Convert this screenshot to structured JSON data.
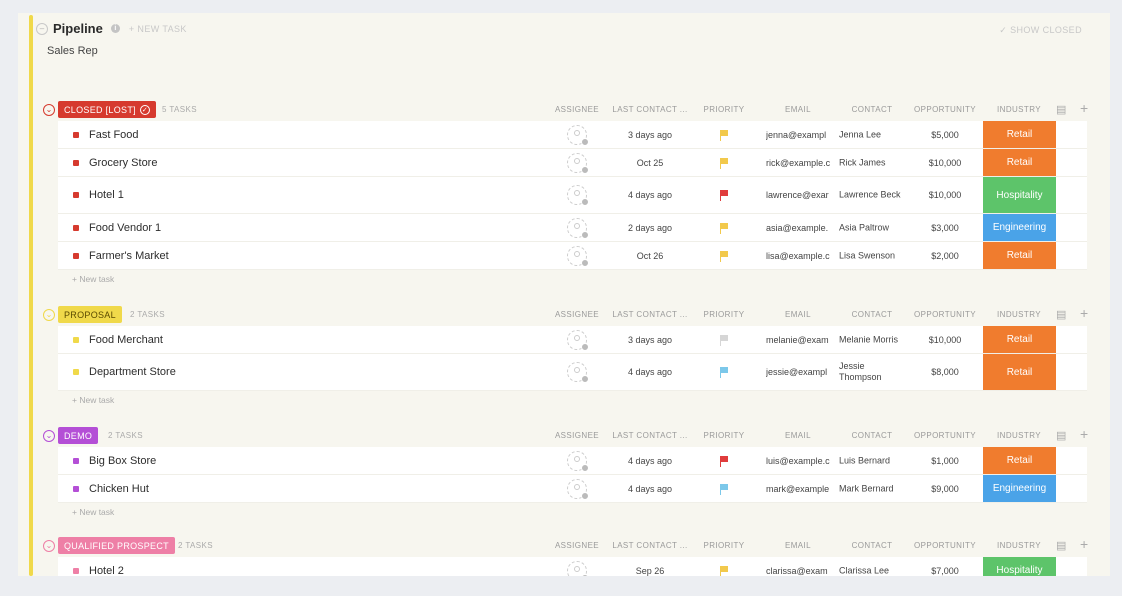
{
  "header": {
    "title": "Pipeline",
    "new_task": "+ NEW TASK",
    "subtitle": "Sales Rep",
    "show_closed": "✓ SHOW CLOSED"
  },
  "columns": [
    "ASSIGNEE",
    "LAST CONTACT ...",
    "PRIORITY",
    "EMAIL",
    "CONTACT",
    "OPPORTUNITY",
    "INDUSTRY"
  ],
  "new_task_label": "+ New task",
  "colors": {
    "priority": {
      "urgent": "#e03c3c",
      "high": "#f2c94c",
      "normal": "#7cc8ea",
      "low": "#d6d6d6"
    },
    "industry": {
      "Retail": "#f07c2e",
      "Hospitality": "#5dc46a",
      "Engineering": "#4aa3e8"
    }
  },
  "groups": [
    {
      "status": "CLOSED [LOST]",
      "color": "#d63a2e",
      "has_check": true,
      "count": "5 TASKS",
      "tasks": [
        {
          "name": "Fast Food",
          "last_contact": "3 days ago",
          "priority": "high",
          "email": "jenna@exampl",
          "contact": "Jenna Lee",
          "opportunity": "$5,000",
          "industry": "Retail"
        },
        {
          "name": "Grocery Store",
          "last_contact": "Oct 25",
          "priority": "high",
          "email": "rick@example.c",
          "contact": "Rick James",
          "opportunity": "$10,000",
          "industry": "Retail"
        },
        {
          "name": "Hotel 1",
          "last_contact": "4 days ago",
          "priority": "urgent",
          "email": "lawrence@exar",
          "contact": "Lawrence Beck",
          "opportunity": "$10,000",
          "industry": "Hospitality"
        },
        {
          "name": "Food Vendor 1",
          "last_contact": "2 days ago",
          "priority": "high",
          "email": "asia@example.",
          "contact": "Asia Paltrow",
          "opportunity": "$3,000",
          "industry": "Engineering"
        },
        {
          "name": "Farmer's Market",
          "last_contact": "Oct 26",
          "priority": "high",
          "email": "lisa@example.c",
          "contact": "Lisa Swenson",
          "opportunity": "$2,000",
          "industry": "Retail"
        }
      ]
    },
    {
      "status": "PROPOSAL",
      "color": "#f0d94a",
      "text_color": "#5a4a00",
      "count": "2 TASKS",
      "tasks": [
        {
          "name": "Food Merchant",
          "last_contact": "3 days ago",
          "priority": "low",
          "email": "melanie@exam",
          "contact": "Melanie Morris",
          "opportunity": "$10,000",
          "industry": "Retail"
        },
        {
          "name": "Department Store",
          "last_contact": "4 days ago",
          "priority": "normal",
          "email": "jessie@exampl",
          "contact": "Jessie Thompson",
          "opportunity": "$8,000",
          "industry": "Retail"
        }
      ]
    },
    {
      "status": "DEMO",
      "color": "#b44fd6",
      "count": "2 TASKS",
      "tasks": [
        {
          "name": "Big Box Store",
          "last_contact": "4 days ago",
          "priority": "urgent",
          "email": "luis@example.c",
          "contact": "Luis Bernard",
          "opportunity": "$1,000",
          "industry": "Retail"
        },
        {
          "name": "Chicken Hut",
          "last_contact": "4 days ago",
          "priority": "normal",
          "email": "mark@example",
          "contact": "Mark Bernard",
          "opportunity": "$9,000",
          "industry": "Engineering"
        }
      ]
    },
    {
      "status": "QUALIFIED PROSPECT",
      "color": "#ee7fa6",
      "count": "2 TASKS",
      "tasks": [
        {
          "name": "Hotel 2",
          "last_contact": "Sep 26",
          "priority": "high",
          "email": "clarissa@exam",
          "contact": "Clarissa Lee",
          "opportunity": "$7,000",
          "industry": "Hospitality"
        }
      ]
    }
  ]
}
